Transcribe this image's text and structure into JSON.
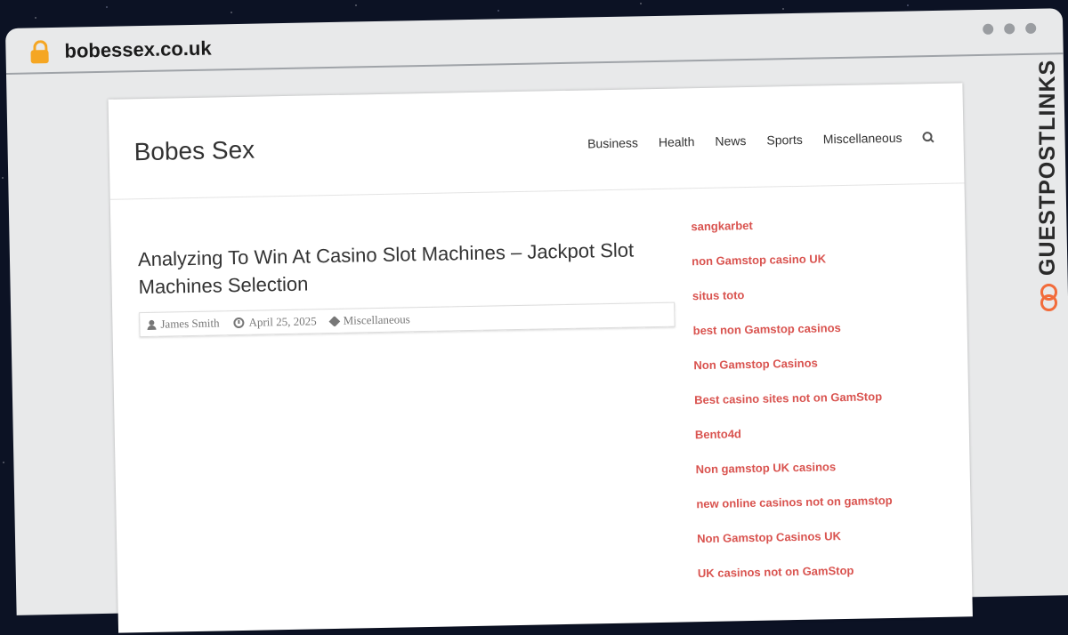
{
  "browser": {
    "url": "bobessex.co.uk"
  },
  "site": {
    "title": "Bobes Sex",
    "nav": [
      "Business",
      "Health",
      "News",
      "Sports",
      "Miscellaneous"
    ]
  },
  "article": {
    "title": "Analyzing To Win At Casino Slot Machines – Jackpot Slot Machines Selection",
    "author": "James Smith",
    "date": "April 25, 2025",
    "category": "Miscellaneous"
  },
  "sidebar": {
    "links": [
      "sangkarbet",
      "non Gamstop casino UK",
      "situs toto",
      "best non Gamstop casinos",
      "Non Gamstop Casinos",
      "Best casino sites not on GamStop",
      "Bento4d",
      "Non gamstop UK casinos",
      "new online casinos not on gamstop",
      "Non Gamstop Casinos UK",
      "UK casinos not on GamStop"
    ]
  },
  "brand": {
    "watermark": "GUESTPOSTLINKS"
  },
  "colors": {
    "link": "#d9534f",
    "lock": "#f5a623",
    "brand_accent": "#f26b3a"
  }
}
